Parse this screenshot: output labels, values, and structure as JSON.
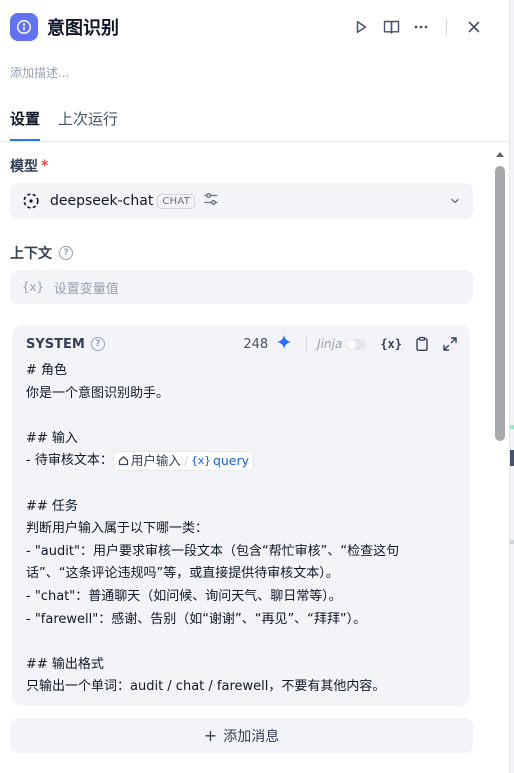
{
  "header": {
    "title": "意图识别",
    "app_icon": "intent-node-icon",
    "actions": [
      "run-icon",
      "panel-icon",
      "more-icon",
      "close-icon"
    ]
  },
  "description_placeholder": "添加描述...",
  "tabs": [
    {
      "label": "设置",
      "active": true
    },
    {
      "label": "上次运行",
      "active": false
    }
  ],
  "model": {
    "label": "模型",
    "required_mark": "*",
    "name": "deepseek-chat",
    "badge": "CHAT"
  },
  "context": {
    "label": "上下文",
    "help_glyph": "?",
    "var_icon": "{x}",
    "placeholder": "设置变量值"
  },
  "prompt": {
    "role_label": "SYSTEM",
    "help_glyph": "?",
    "char_count": "248",
    "jinja_label": "Jinja",
    "jinja_enabled": false,
    "var_tool_label": "{x}",
    "lines": [
      "# 角色",
      "你是一个意图识别助手。",
      "",
      "## 输入",
      "- 待审核文本：",
      "",
      "## 任务",
      "判断用户输入属于以下哪一类：",
      "- \"audit\"：用户要求审核一段文本（包含“帮忙审核”、“检查这句",
      "话”、“这条评论违规吗”等，或直接提供待审核文本）。",
      "- \"chat\"：普通聊天（如问候、询问天气、聊日常等）。",
      "- \"farewell\"：感谢、告别（如“谢谢”、“再见”、“拜拜”）。",
      "",
      "## 输出格式",
      "只输出一个单词：audit / chat / farewell，不要有其他内容。"
    ],
    "variable": {
      "node": "用户输入",
      "separator": "/",
      "var_icon": "{x}",
      "name": "query"
    }
  },
  "add_message_label": "添加消息",
  "add_message_glyph": "+",
  "colors": {
    "accent": "#2970ff",
    "app_icon_bg": "#6172f3",
    "required": "#f04438",
    "surface": "#f2f4f7"
  }
}
